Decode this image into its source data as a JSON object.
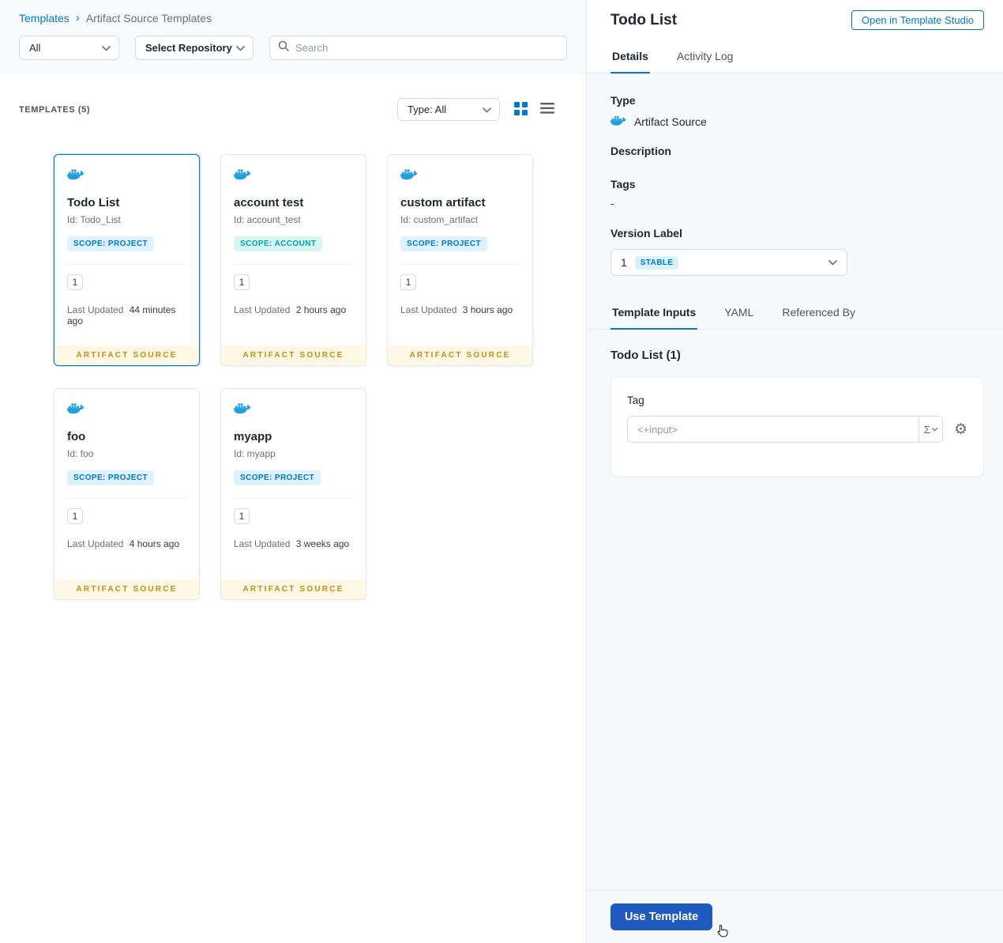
{
  "colors": {
    "primary": "#0278d5",
    "docker_blue": "#1d9fe0",
    "artifact_badge_bg": "#fff8e4",
    "artifact_badge_text": "#c98d0e",
    "use_template_bg": "#2059c0",
    "panel_bg": "#f7fafd"
  },
  "breadcrumb": {
    "link": "Templates",
    "separator": "›",
    "current": "Artifact Source Templates"
  },
  "filters": {
    "scope": "All",
    "repository": "Select Repository",
    "search_placeholder": "Search"
  },
  "list_header": {
    "count": "TEMPLATES (5)",
    "type_filter": "Type: All"
  },
  "cards": [
    {
      "name": "Todo List",
      "id": "Id: Todo_List",
      "scope": "SCOPE: PROJECT",
      "scope_type": "project",
      "version": "1",
      "updated_label": "Last Updated",
      "updated": "44 minutes ago",
      "footer": "ARTIFACT SOURCE",
      "selected": "true"
    },
    {
      "name": "account test",
      "id": "Id: account_test",
      "scope": "SCOPE: ACCOUNT",
      "scope_type": "account",
      "version": "1",
      "updated_label": "Last Updated",
      "updated": "2 hours ago",
      "footer": "ARTIFACT SOURCE",
      "selected": "false"
    },
    {
      "name": "custom artifact",
      "id": "Id: custom_artifact",
      "scope": "SCOPE: PROJECT",
      "scope_type": "project",
      "version": "1",
      "updated_label": "Last Updated",
      "updated": "3 hours ago",
      "footer": "ARTIFACT SOURCE",
      "selected": "false"
    },
    {
      "name": "foo",
      "id": "Id: foo",
      "scope": "SCOPE: PROJECT",
      "scope_type": "project",
      "version": "1",
      "updated_label": "Last Updated",
      "updated": "4 hours ago",
      "footer": "ARTIFACT SOURCE",
      "selected": "false"
    },
    {
      "name": "myapp",
      "id": "Id: myapp",
      "scope": "SCOPE: PROJECT",
      "scope_type": "project",
      "version": "1",
      "updated_label": "Last Updated",
      "updated": "3 weeks ago",
      "footer": "ARTIFACT SOURCE",
      "selected": "false"
    }
  ],
  "panel": {
    "title": "Todo List",
    "open_studio": "Open in Template Studio",
    "tabs": {
      "details": "Details",
      "activity": "Activity Log"
    },
    "type_label": "Type",
    "type_value": "Artifact Source",
    "description_label": "Description",
    "tags_label": "Tags",
    "tags_value": "-",
    "version_label": "Version Label",
    "version_value": "1",
    "version_badge": "STABLE",
    "input_tabs": {
      "inputs": "Template Inputs",
      "yaml": "YAML",
      "referenced": "Referenced By"
    },
    "inputs_title": "Todo List (1)",
    "tag_label": "Tag",
    "tag_value": "<+input>",
    "expression_symbol": "Σ",
    "use_template": "Use Template"
  },
  "icons": {
    "gear": "⚙"
  }
}
